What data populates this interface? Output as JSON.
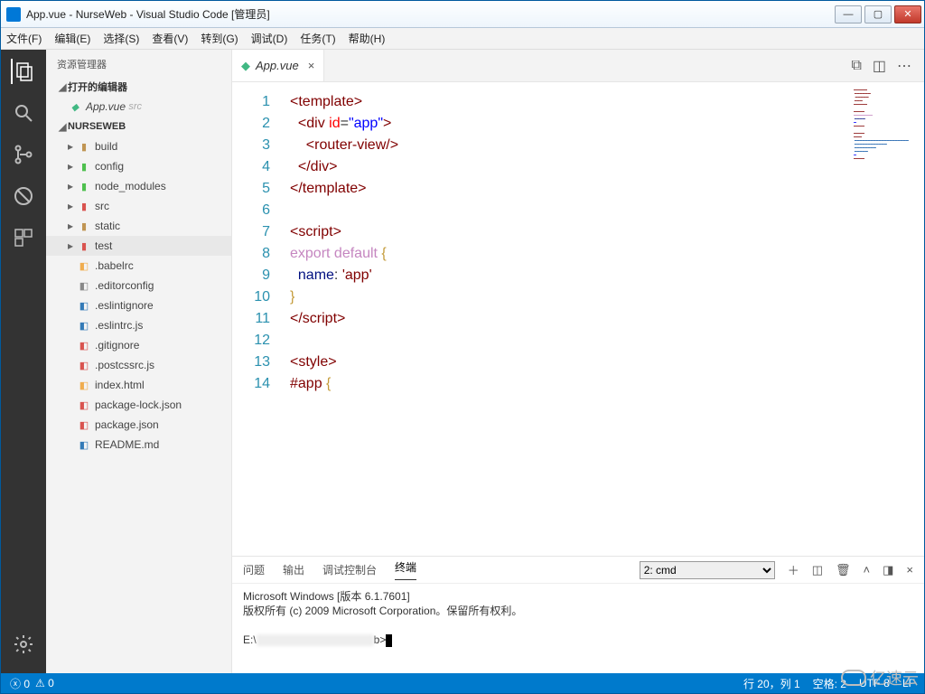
{
  "window": {
    "title": "App.vue - NurseWeb - Visual Studio Code [管理员]"
  },
  "menu": [
    "文件(F)",
    "编辑(E)",
    "选择(S)",
    "查看(V)",
    "转到(G)",
    "调试(D)",
    "任务(T)",
    "帮助(H)"
  ],
  "explorer": {
    "title": "资源管理器",
    "open_editors": "打开的编辑器",
    "open_file": "App.vue",
    "open_file_hint": "src",
    "project": "NURSEWEB",
    "tree": [
      {
        "label": "build",
        "icon": "folder",
        "color": "ic-folder",
        "chev": "▸"
      },
      {
        "label": "config",
        "icon": "folder",
        "color": "ic-green",
        "chev": "▸"
      },
      {
        "label": "node_modules",
        "icon": "folder",
        "color": "ic-green",
        "chev": "▸"
      },
      {
        "label": "src",
        "icon": "folder",
        "color": "ic-red",
        "chev": "▸"
      },
      {
        "label": "static",
        "icon": "folder",
        "color": "ic-folder",
        "chev": "▸"
      },
      {
        "label": "test",
        "icon": "folder",
        "color": "ic-red",
        "chev": "▸",
        "sel": true
      },
      {
        "label": ".babelrc",
        "icon": "file",
        "color": "ic-orange"
      },
      {
        "label": ".editorconfig",
        "icon": "file",
        "color": "ic-gray"
      },
      {
        "label": ".eslintignore",
        "icon": "file",
        "color": "ic-blue"
      },
      {
        "label": ".eslintrc.js",
        "icon": "file",
        "color": "ic-blue"
      },
      {
        "label": ".gitignore",
        "icon": "file",
        "color": "ic-red"
      },
      {
        "label": ".postcssrc.js",
        "icon": "file",
        "color": "ic-red"
      },
      {
        "label": "index.html",
        "icon": "file",
        "color": "ic-orange"
      },
      {
        "label": "package-lock.json",
        "icon": "file",
        "color": "ic-red"
      },
      {
        "label": "package.json",
        "icon": "file",
        "color": "ic-red"
      },
      {
        "label": "README.md",
        "icon": "file",
        "color": "ic-blue"
      }
    ]
  },
  "tabs": {
    "active": "App.vue"
  },
  "code": {
    "lines": [
      {
        "n": 1,
        "html": "<span class='t-tag'>&lt;template&gt;</span>"
      },
      {
        "n": 2,
        "html": "  <span class='t-tag'>&lt;div</span> <span class='t-attr'>id</span>=<span class='t-str'>\"app\"</span><span class='t-tag'>&gt;</span>"
      },
      {
        "n": 3,
        "html": "    <span class='t-tag'>&lt;router-view/&gt;</span>"
      },
      {
        "n": 4,
        "html": "  <span class='t-tag'>&lt;/div&gt;</span>"
      },
      {
        "n": 5,
        "html": "<span class='t-tag'>&lt;/template&gt;</span>"
      },
      {
        "n": 6,
        "html": ""
      },
      {
        "n": 7,
        "html": "<span class='t-tag'>&lt;script&gt;</span>"
      },
      {
        "n": 8,
        "html": "<span class='t-kw2'>export</span> <span class='t-kw2'>default</span> <span class='t-brace'>{</span>"
      },
      {
        "n": 9,
        "html": "  <span class='t-id'>name</span>: <span class='t-sel'>'app'</span>"
      },
      {
        "n": 10,
        "html": "<span class='t-brace'>}</span>"
      },
      {
        "n": 11,
        "html": "<span class='t-tag'>&lt;/script&gt;</span>"
      },
      {
        "n": 12,
        "html": ""
      },
      {
        "n": 13,
        "html": "<span class='t-tag'>&lt;style&gt;</span>"
      },
      {
        "n": 14,
        "html": "<span class='t-sel'>#app</span> <span class='t-brace'>{</span>"
      }
    ]
  },
  "panel": {
    "tabs": [
      "问题",
      "输出",
      "调试控制台",
      "终端"
    ],
    "active": 3,
    "selector": "2: cmd",
    "body_l1": "Microsoft Windows [版本 6.1.7601]",
    "body_l2": "版权所有 (c) 2009 Microsoft Corporation。保留所有权利。",
    "prompt_pre": "E:\\",
    "prompt_post": "b>"
  },
  "status": {
    "errors": "0",
    "warnings": "0",
    "pos": "行 20，列 1",
    "spaces": "空格: 2",
    "enc": "UTF-8",
    "eol": "LF"
  },
  "watermark": "亿速云"
}
